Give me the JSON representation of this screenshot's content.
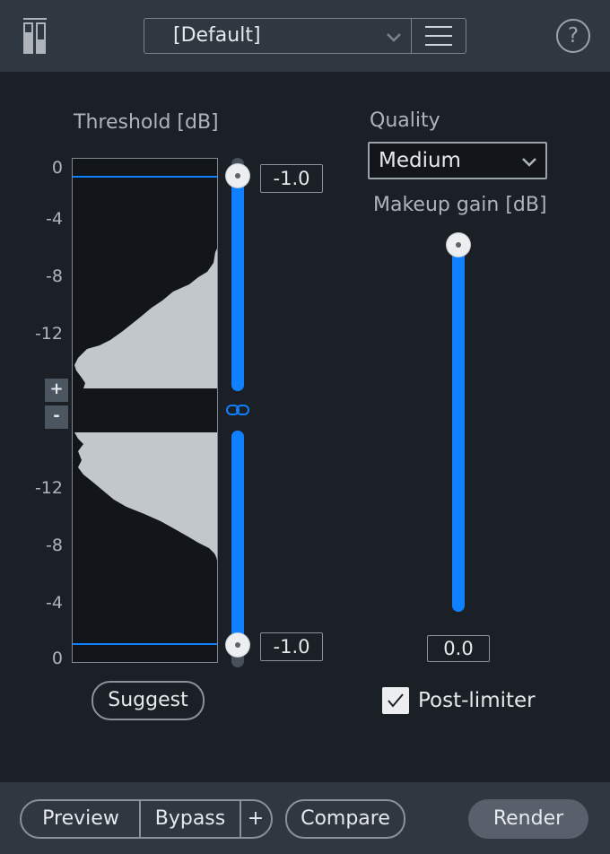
{
  "header": {
    "preset_label": "[Default]",
    "icons": {
      "app": "meter-bars-icon",
      "chevron": "chevron-down-icon",
      "menu": "hamburger-menu-icon",
      "help": "help-icon"
    },
    "help_glyph": "?"
  },
  "threshold": {
    "title": "Threshold [dB]",
    "top_ticks": [
      "0",
      "-4",
      "-8",
      "-12"
    ],
    "bottom_ticks": [
      "-12",
      "-8",
      "-4",
      "0"
    ],
    "top_value": "-1.0",
    "bottom_value": "-1.0",
    "top_level_db": -1.0,
    "bottom_level_db": -1.0,
    "zoom_in_label": "+",
    "zoom_out_label": "-",
    "link_icon": "link-icon",
    "suggest_label": "Suggest"
  },
  "quality": {
    "title": "Quality",
    "selected": "Medium"
  },
  "makeup": {
    "title": "Makeup gain [dB]",
    "value": "0.0",
    "level_db": 0.0
  },
  "post_limiter": {
    "label": "Post-limiter",
    "checked": true,
    "check_glyph": "✓"
  },
  "footer": {
    "preview_label": "Preview",
    "bypass_label": "Bypass",
    "plus_label": "+",
    "compare_label": "Compare",
    "render_label": "Render"
  },
  "colors": {
    "accent": "#0f80ff",
    "panel": "#1b2026",
    "bar": "#2f3841",
    "histogram": "#c2c7cc"
  }
}
